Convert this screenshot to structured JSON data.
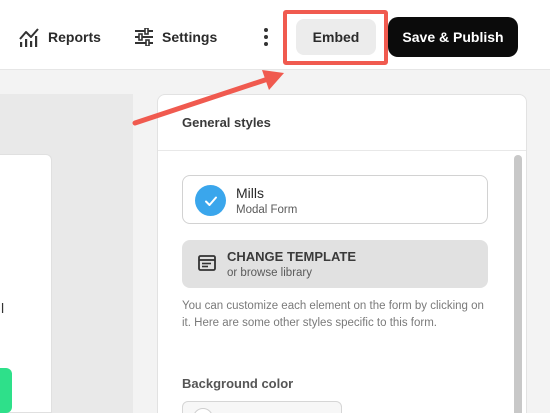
{
  "topbar": {
    "reports_label": "Reports",
    "settings_label": "Settings",
    "embed_label": "Embed",
    "publish_label": "Save & Publish"
  },
  "panel": {
    "title": "General styles",
    "template": {
      "name": "Mills",
      "type": "Modal Form"
    },
    "change_template": {
      "title": "CHANGE TEMPLATE",
      "subtitle": "or browse library"
    },
    "help_text": "You can customize each element on the form by clicking on it. Here are some other styles specific to this form.",
    "background_label": "Background color"
  },
  "canvas": {
    "partial_text": "l"
  },
  "colors": {
    "highlight": "#f05a4f",
    "accent_blue": "#3aa6ec",
    "accent_green": "#2ee08a",
    "publish_bg": "#0b0b0b"
  },
  "icons": [
    "reports-icon",
    "settings-sliders-icon",
    "more-vertical-icon",
    "check-icon",
    "template-icon"
  ]
}
